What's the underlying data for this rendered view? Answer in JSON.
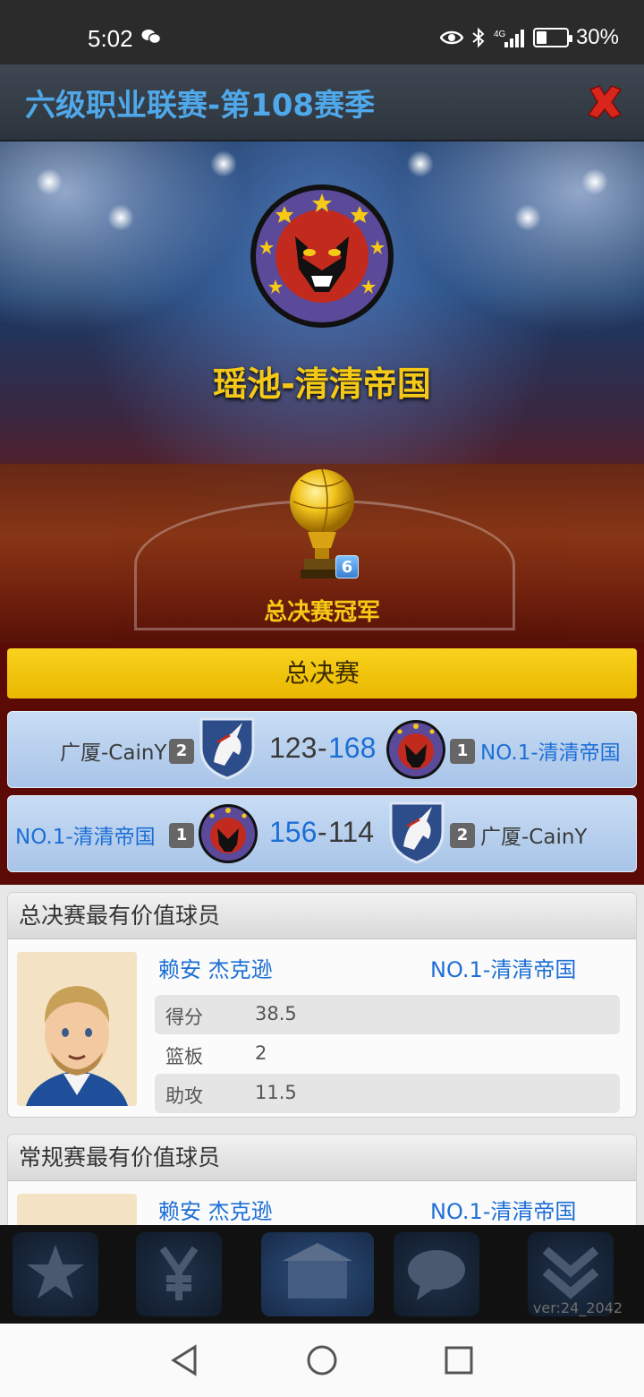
{
  "status_bar": {
    "time": "5:02",
    "battery": "30%",
    "battery_level": 0.3,
    "network": "4G",
    "icons": [
      "wechat-icon",
      "eye-icon",
      "bluetooth-icon",
      "signal-icon",
      "battery-icon"
    ]
  },
  "header": {
    "title": "六级职业联赛-第108赛季",
    "close_icon": "close-icon"
  },
  "banner": {
    "team_name": "瑶池-清清帝国",
    "trophy_count": "6",
    "champion_label": "总决赛冠军"
  },
  "finals": {
    "label": "总决赛",
    "games": [
      {
        "left_team": "广厦-CainY",
        "left_seed": "2",
        "left_score": "123",
        "right_score": "168",
        "right_seed": "1",
        "right_team": "NO.1-清清帝国",
        "separator": "-"
      },
      {
        "left_team": "NO.1-清清帝国",
        "left_seed": "1",
        "left_score": "156",
        "right_score": "114",
        "right_seed": "2",
        "right_team": "广厦-CainY",
        "separator": "-"
      }
    ]
  },
  "finals_mvp": {
    "title": "总决赛最有价值球员",
    "player_name": "赖安 杰克逊",
    "team": "NO.1-清清帝国",
    "stats": [
      {
        "label": "得分",
        "value": "38.5"
      },
      {
        "label": "篮板",
        "value": "2"
      },
      {
        "label": "助攻",
        "value": "11.5"
      }
    ]
  },
  "regular_mvp": {
    "title": "常规赛最有价值球员",
    "player_name": "赖安 杰克逊",
    "team": "NO.1-清清帝国"
  },
  "game_nav": {
    "version": "ver:24_2042"
  },
  "colors": {
    "accent_blue": "#1d6fd6",
    "header_title": "#4fa8ea",
    "gold": "#f5c916",
    "finals_bar": "#f9d21d"
  }
}
